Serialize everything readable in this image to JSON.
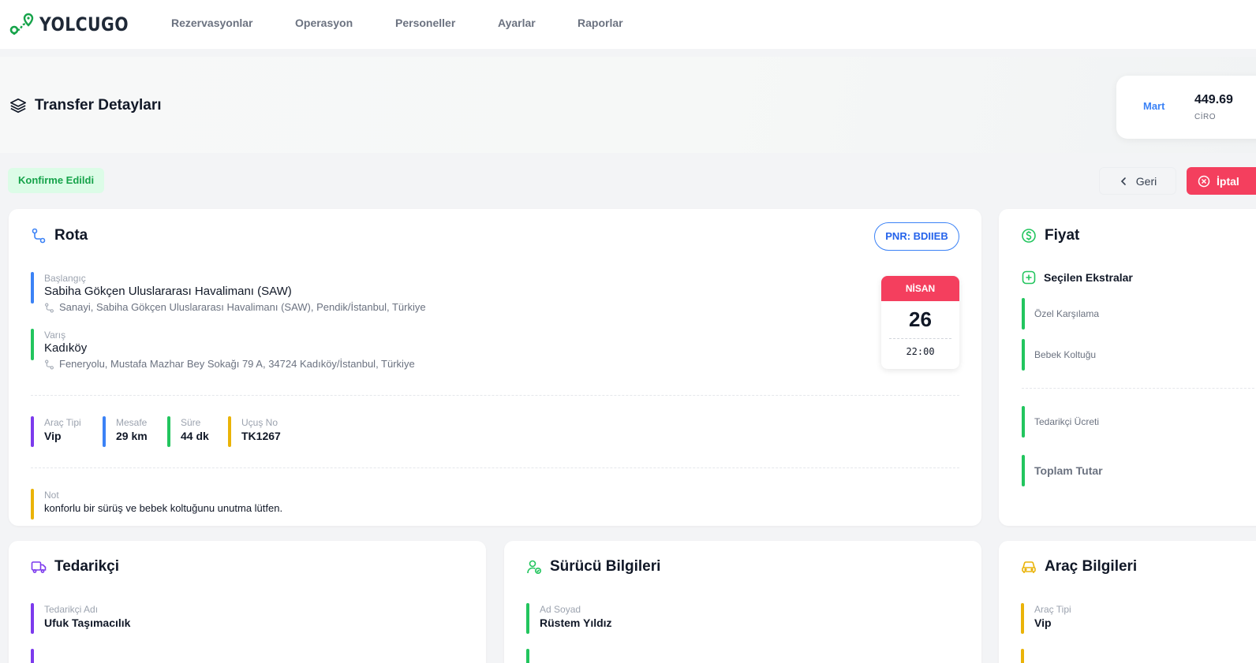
{
  "brand": {
    "name": "YOLCUGO"
  },
  "nav": {
    "items": [
      "Rezervasyonlar",
      "Operasyon",
      "Personeller",
      "Ayarlar",
      "Raporlar"
    ]
  },
  "header": {
    "title": "Transfer Detayları",
    "stat": {
      "month": "Mart",
      "value": "449.69",
      "label": "CİRO"
    }
  },
  "status": {
    "label": "Konfirme Edildi"
  },
  "actions": {
    "back": "Geri",
    "cancel": "İptal"
  },
  "route": {
    "title": "Rota",
    "pnr": "PNR: BDIIEB",
    "start": {
      "label": "Başlangıç",
      "name": "Sabiha Gökçen Uluslararası Havalimanı (SAW)",
      "address": "Sanayi, Sabiha Gökçen Uluslararası Havalimanı (SAW), Pendik/İstanbul, Türkiye"
    },
    "end": {
      "label": "Varış",
      "name": "Kadıköy",
      "address": "Feneryolu, Mustafa Mazhar Bey Sokağı 79 A, 34724 Kadıköy/İstanbul, Türkiye"
    },
    "date": {
      "month": "NİSAN",
      "day": "26",
      "time": "22:00"
    },
    "meta": [
      {
        "label": "Araç Tipi",
        "value": "Vip"
      },
      {
        "label": "Mesafe",
        "value": "29 km"
      },
      {
        "label": "Süre",
        "value": "44 dk"
      },
      {
        "label": "Uçuş No",
        "value": "TK1267"
      }
    ],
    "note": {
      "label": "Not",
      "value": "konforlu bir sürüş ve bebek koltuğunu unutma lütfen."
    }
  },
  "price": {
    "title": "Fiyat",
    "extras_title": "Seçilen Ekstralar",
    "extras": [
      "Özel Karşılama",
      "Bebek Koltuğu"
    ],
    "supplier_fee": "Tedarikçi Ücreti",
    "total": "Toplam Tutar"
  },
  "supplier": {
    "title": "Tedarikçi",
    "name_label": "Tedarikçi Adı",
    "name": "Ufuk Taşımacılık"
  },
  "driver": {
    "title": "Sürücü Bilgileri",
    "name_label": "Ad Soyad",
    "name": "Rüstem Yıldız"
  },
  "vehicle": {
    "title": "Araç Bilgileri",
    "type_label": "Araç Tipi",
    "type": "Vip"
  },
  "colors": {
    "accent": "#3b82f6",
    "success": "#22c55e",
    "danger": "#f43f5e",
    "purple": "#7c3aed",
    "amber": "#eab308"
  }
}
